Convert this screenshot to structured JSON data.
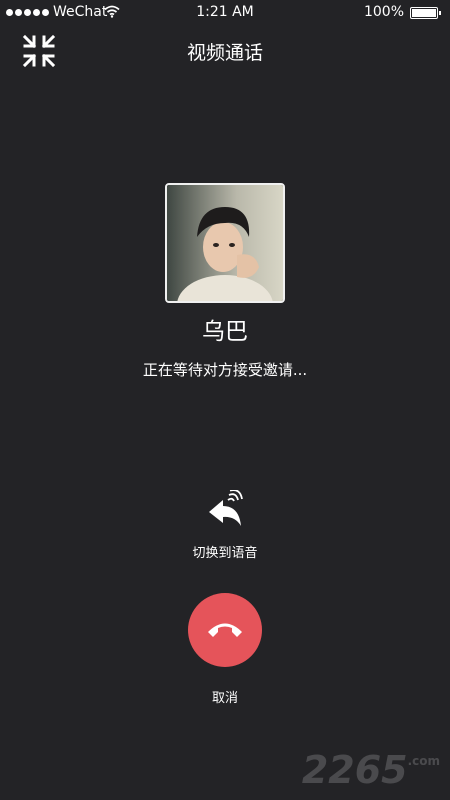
{
  "status_bar": {
    "carrier": "WeChat",
    "time": "1:21 AM",
    "battery": "100%"
  },
  "header": {
    "title": "视频通话"
  },
  "caller": {
    "name": "乌巴",
    "status": "正在等待对方接受邀请..."
  },
  "actions": {
    "switch_to_voice": "切换到语音",
    "cancel": "取消"
  },
  "watermark": {
    "text": "2265",
    "sub": ".com"
  },
  "colors": {
    "background": "#232326",
    "hangup": "#e5545a",
    "text": "#ffffff"
  }
}
